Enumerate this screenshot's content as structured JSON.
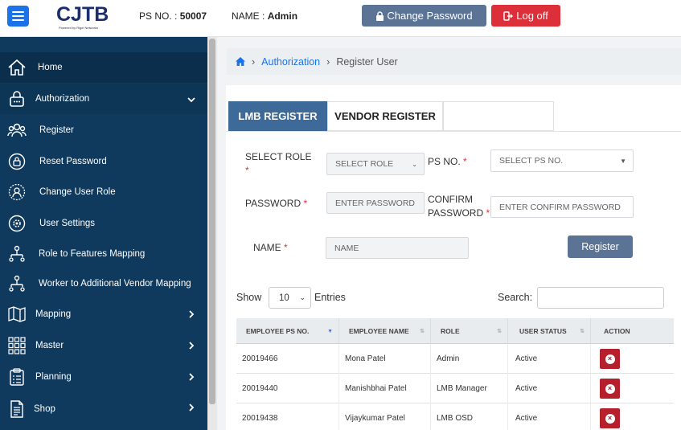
{
  "header": {
    "logo_text": "CJTB",
    "logo_tagline": "Powered by Rigel Networks",
    "ps_label": "PS NO. :",
    "ps_value": "50007",
    "name_label": "NAME :",
    "name_value": "Admin",
    "change_password": "Change Password",
    "log_off": "Log off"
  },
  "sidebar": {
    "items": [
      {
        "label": "Home",
        "icon": "home-icon"
      },
      {
        "label": "Authorization",
        "icon": "lock-icon"
      },
      {
        "label": "Register",
        "icon": "users-icon"
      },
      {
        "label": "Reset Password",
        "icon": "reset-lock-icon"
      },
      {
        "label": "Change User Role",
        "icon": "user-role-icon"
      },
      {
        "label": "User Settings",
        "icon": "gear-icon"
      },
      {
        "label": "Role to Features Mapping",
        "icon": "org-chart-icon"
      },
      {
        "label": "Worker to Additional Vendor Mapping",
        "icon": "org-chart-icon"
      },
      {
        "label": "Mapping",
        "icon": "map-icon"
      },
      {
        "label": "Master",
        "icon": "grid-icon"
      },
      {
        "label": "Planning",
        "icon": "clipboard-icon"
      },
      {
        "label": "Shop",
        "icon": "document-icon"
      }
    ]
  },
  "breadcrumb": {
    "items": [
      "Authorization",
      "Register User"
    ]
  },
  "tabs": [
    {
      "label": "LMB REGISTER",
      "active": true
    },
    {
      "label": "VENDOR REGISTER",
      "active": false
    },
    {
      "label": "",
      "active": false
    }
  ],
  "form": {
    "select_role_label": "SELECT ROLE",
    "select_role_value": "SELECT ROLE",
    "ps_no_label": "PS NO.",
    "ps_no_value": "SELECT PS NO.",
    "password_label": "PASSWORD",
    "password_placeholder": "ENTER PASSWORD",
    "confirm_label_1": "CONFIRM",
    "confirm_label_2": "PASSWORD",
    "confirm_placeholder": "ENTER CONFIRM PASSWORD",
    "name_label": "NAME",
    "name_placeholder": "NAME",
    "required_mark": "*",
    "register_button": "Register"
  },
  "table_controls": {
    "show": "Show",
    "entries_value": "10",
    "entries": "Entries",
    "search_label": "Search:"
  },
  "table": {
    "columns": [
      "EMPLOYEE PS NO.",
      "EMPLOYEE NAME",
      "ROLE",
      "USER STATUS",
      "ACTION"
    ],
    "rows": [
      {
        "ps": "20019466",
        "name": "Mona Patel",
        "role": "Admin",
        "status": "Active"
      },
      {
        "ps": "20019440",
        "name": "Manishbhai Patel",
        "role": "LMB Manager",
        "status": "Active"
      },
      {
        "ps": "20019438",
        "name": "Vijaykumar Patel",
        "role": "LMB OSD",
        "status": "Active"
      }
    ]
  },
  "colors": {
    "sidebar_bg": "#0f3a5d",
    "accent": "#1a73e8",
    "tab_active": "#3d6a98",
    "danger": "#dc2f3a"
  }
}
